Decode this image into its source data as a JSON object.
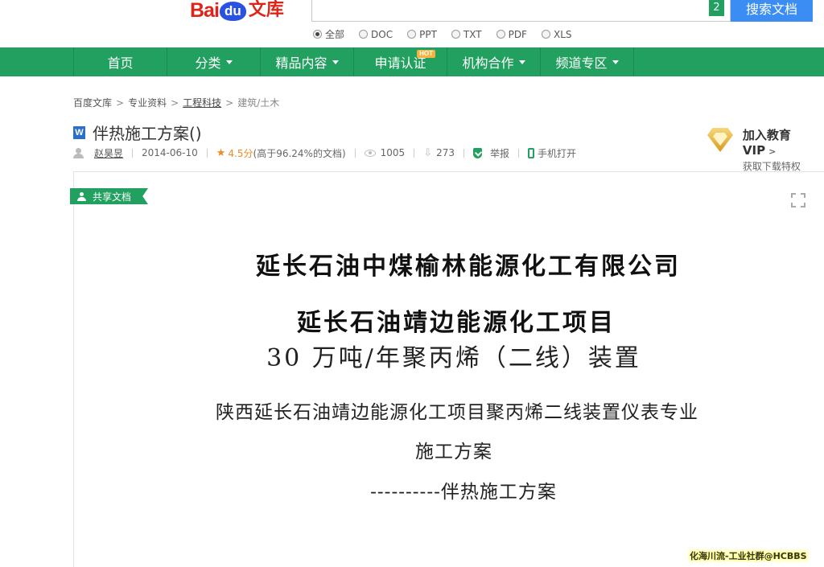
{
  "header": {
    "logo_bai": "Bai",
    "logo_du": "du",
    "logo_wenku": "文库",
    "search_value": "",
    "search_count": "2",
    "search_button": "搜索文档",
    "filetypes": [
      "全部",
      "DOC",
      "PPT",
      "TXT",
      "PDF",
      "XLS"
    ],
    "selected_filetype": "全部"
  },
  "nav": {
    "items": [
      {
        "label": "首页",
        "has_caret": false
      },
      {
        "label": "分类",
        "has_caret": true
      },
      {
        "label": "精品内容",
        "has_caret": true
      },
      {
        "label": "申请认证",
        "has_caret": false,
        "badge": "HOT"
      },
      {
        "label": "机构合作",
        "has_caret": true
      },
      {
        "label": "频道专区",
        "has_caret": true
      }
    ],
    "color": "#21a05f"
  },
  "breadcrumb": [
    "百度文库",
    "专业资料",
    "工程科技",
    "建筑/土木"
  ],
  "doc": {
    "type_icon": "W",
    "title": "伴热施工方案()",
    "author": "赵昊昱",
    "date": "2014-06-10",
    "rating": "4.5分",
    "rating_note": "(高于96.24%的文档)",
    "views": "1005",
    "downloads": "273",
    "report": "举报",
    "mobile": "手机打开"
  },
  "vip": {
    "line1": "加入教育VIP",
    "line2": "获取下载特权",
    "arrow": ">"
  },
  "share_tag": "共享文档",
  "content": {
    "line1": "延长石油中煤榆林能源化工有限公司",
    "line2": "延长石油靖边能源化工项目",
    "line3": "30 万吨/年聚丙烯（二线）装置",
    "line4": "陕西延长石油靖边能源化工项目聚丙烯二线装置仪表专业",
    "line5": "施工方案",
    "line6": "----------伴热施工方案"
  },
  "watermark": "化海川流-工业社群@HCBBS"
}
